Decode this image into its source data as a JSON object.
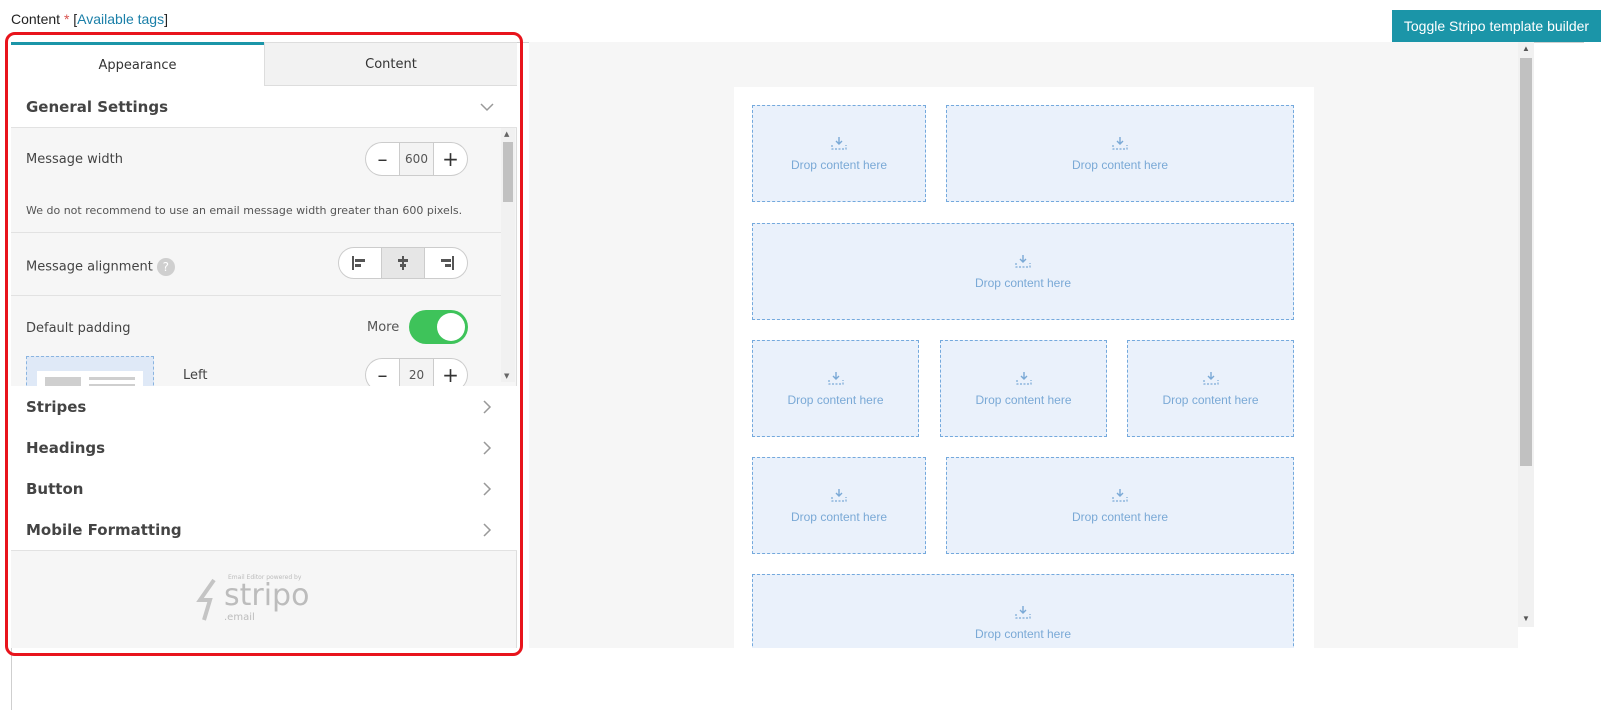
{
  "header": {
    "content_label": "Content",
    "required_mark": "*",
    "bracket_open": "[",
    "available_tags": "Available tags",
    "bracket_close": "]",
    "toggle_button": "Toggle Stripo template builder"
  },
  "tabs": [
    {
      "label": "Appearance",
      "active": true
    },
    {
      "label": "Content",
      "active": false
    }
  ],
  "general_settings": {
    "title": "General Settings",
    "message_width": {
      "label": "Message width",
      "value": "600",
      "minus": "–",
      "plus": "+"
    },
    "hint": "We do not recommend to use an email message width greater than 600 pixels.",
    "message_alignment": {
      "label": "Message alignment",
      "help": "?",
      "options": [
        "left",
        "center",
        "right"
      ],
      "selected": "center"
    },
    "default_padding": {
      "label": "Default padding",
      "more_label": "More",
      "toggle_on": true
    },
    "left_padding": {
      "label": "Left",
      "value": "20",
      "minus": "–",
      "plus": "+"
    }
  },
  "sections": [
    {
      "title": "Stripes"
    },
    {
      "title": "Headings"
    },
    {
      "title": "Button"
    },
    {
      "title": "Mobile Formatting"
    }
  ],
  "footer": {
    "powered_by": "Email Editor powered by",
    "brand": "stripo",
    "brand_suffix": ".email"
  },
  "canvas": {
    "drop_label": "Drop content here"
  },
  "colors": {
    "accent": "#1b95a8",
    "toggle_green": "#3ec35a",
    "highlight_outline": "#e8141c",
    "drop_border": "#74a9dd",
    "drop_fill": "#eaf1fb"
  }
}
